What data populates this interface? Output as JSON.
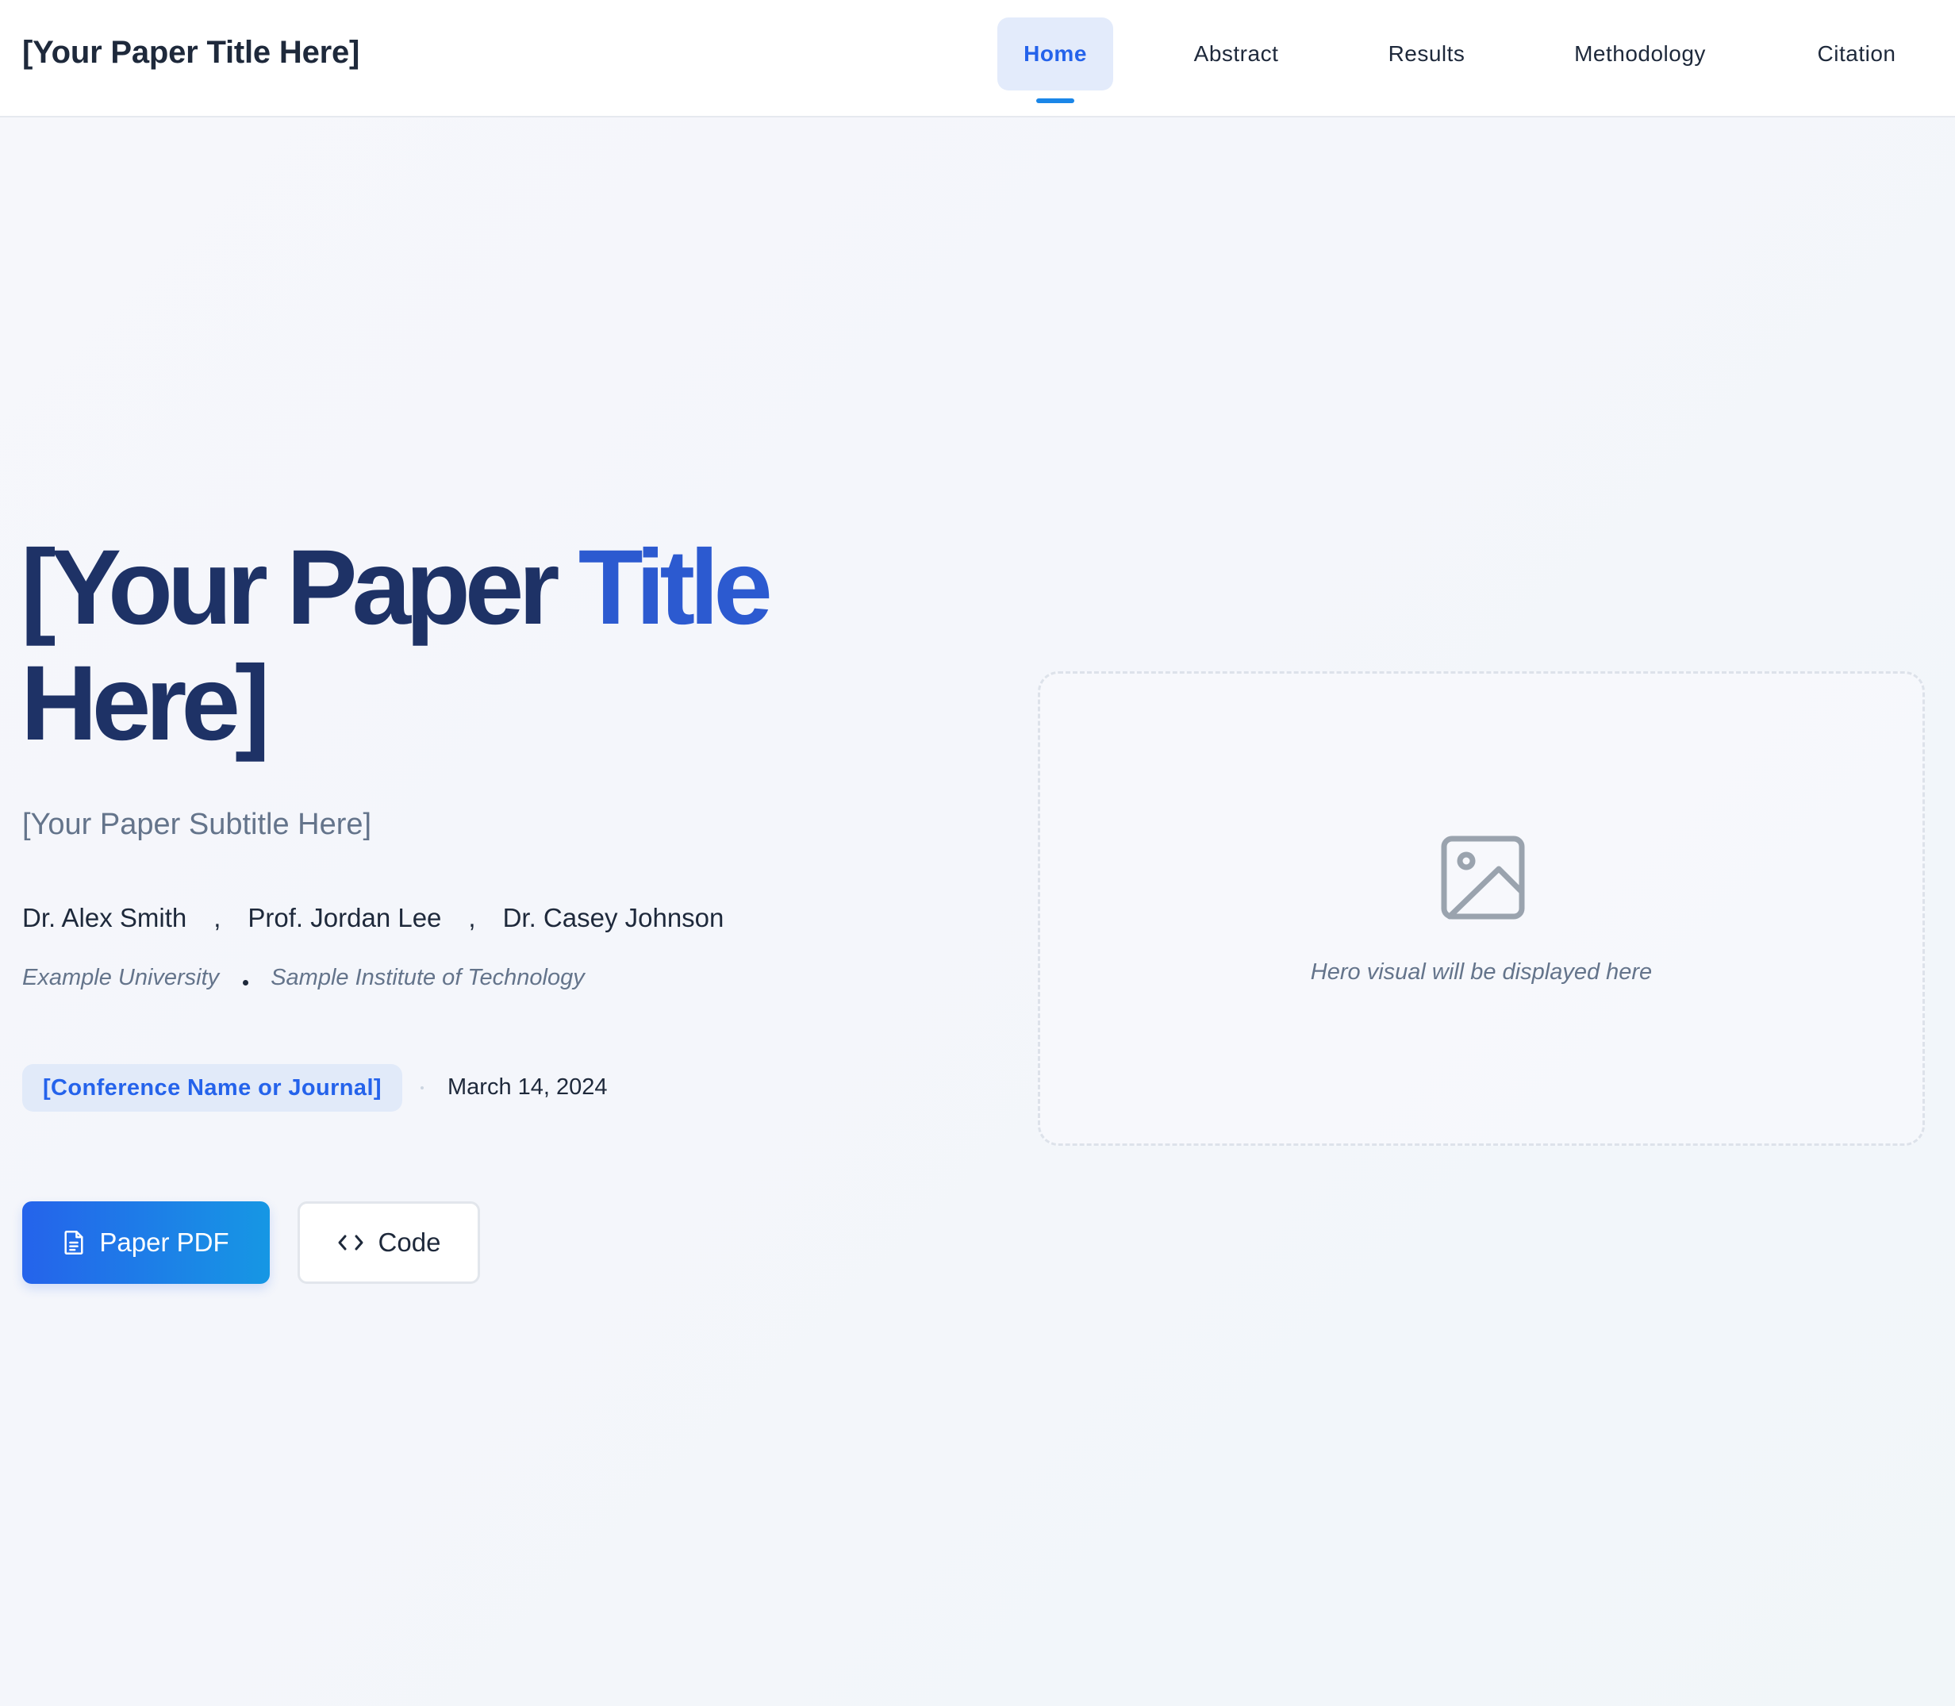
{
  "header": {
    "brand": "[Your Paper Title Here]",
    "nav": [
      {
        "label": "Home",
        "active": true
      },
      {
        "label": "Abstract",
        "active": false
      },
      {
        "label": "Results",
        "active": false
      },
      {
        "label": "Methodology",
        "active": false
      },
      {
        "label": "Citation",
        "active": false
      }
    ]
  },
  "hero": {
    "title_line1_part1": "[Your Paper",
    "title_line1_part2": "Title",
    "title_line2": "Here]",
    "subtitle": "[Your Paper Subtitle Here]",
    "authors": [
      "Dr. Alex Smith",
      "Prof. Jordan Lee",
      "Dr. Casey Johnson"
    ],
    "author_separator": ",",
    "affiliations": [
      "Example University",
      "Sample Institute of Technology"
    ],
    "venue": "[Conference Name or Journal]",
    "date": "March 14, 2024",
    "buttons": {
      "pdf_label": "Paper PDF",
      "pdf_icon": "document-icon",
      "code_label": "Code",
      "code_icon": "code-icon"
    },
    "visual": {
      "icon": "image-icon",
      "caption": "Hero visual will be displayed here"
    }
  },
  "colors": {
    "accent": "#2563eb",
    "title_dark": "#1e3266",
    "title_accent": "#2c5ad0",
    "active_nav_bg": "#e3ebfb",
    "badge_bg": "#e1eaf9",
    "muted_text": "#64748b"
  }
}
